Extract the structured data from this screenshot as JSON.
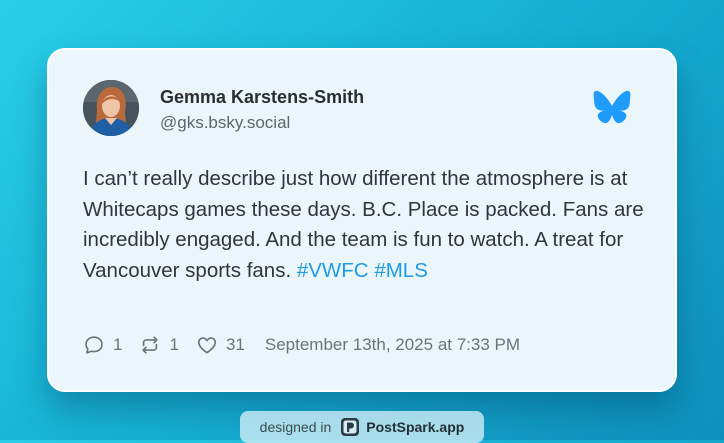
{
  "post": {
    "author": {
      "name": "Gemma Karstens-Smith",
      "handle": "@gks.bsky.social",
      "avatar": "author-avatar-photo"
    },
    "text": "I can’t really describe just how different the atmosphere is at Whitecaps games these days. B.C. Place is packed. Fans are incredibly engaged. And the team is fun to watch. A treat for Vancouver sports fans.",
    "hashtags": [
      "#VWFC",
      "#MLS"
    ],
    "stats": {
      "replies": "1",
      "reposts": "1",
      "likes": "31"
    },
    "timestamp": "September 13th, 2025 at 7:33 PM",
    "platform_icon": "bluesky-butterfly-icon"
  },
  "badge": {
    "prefix": "designed in",
    "brand": "PostSpark.app",
    "icon": "postspark-logo-icon"
  },
  "colors": {
    "background_start": "#28cfe9",
    "background_end": "#0d8fbd",
    "card": "#eaf6fa",
    "hashtag": "#1f9be5",
    "bluesky": "#1f9bfa"
  }
}
